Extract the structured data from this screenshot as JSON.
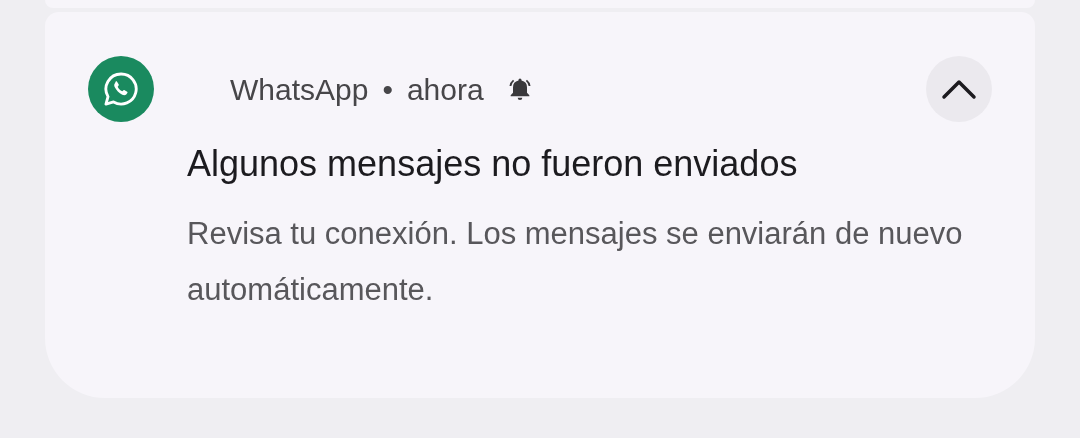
{
  "notification": {
    "app_name": "WhatsApp",
    "separator": "•",
    "time": "ahora",
    "alerting": true,
    "expanded": true,
    "title": "Algunos mensajes no fueron enviados",
    "body": "Revisa tu conexión. Los mensajes se enviarán de nuevo automáticamente."
  }
}
